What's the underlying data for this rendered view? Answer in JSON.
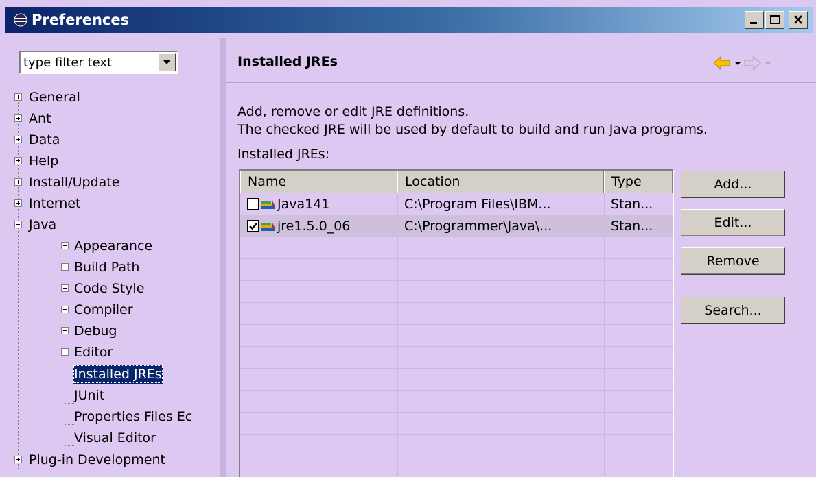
{
  "window": {
    "title": "Preferences",
    "minimize": "minimize",
    "maximize": "maximize",
    "close": "close"
  },
  "filter": {
    "value": "type filter text"
  },
  "tree": {
    "items": [
      {
        "label": "General",
        "expander": "plus"
      },
      {
        "label": "Ant",
        "expander": "plus"
      },
      {
        "label": "Data",
        "expander": "plus"
      },
      {
        "label": "Help",
        "expander": "plus"
      },
      {
        "label": "Install/Update",
        "expander": "plus"
      },
      {
        "label": "Internet",
        "expander": "plus"
      },
      {
        "label": "Java",
        "expander": "minus"
      }
    ],
    "java_children": [
      {
        "label": "Appearance",
        "expander": "plus"
      },
      {
        "label": "Build Path",
        "expander": "plus"
      },
      {
        "label": "Code Style",
        "expander": "plus"
      },
      {
        "label": "Compiler",
        "expander": "plus"
      },
      {
        "label": "Debug",
        "expander": "plus"
      },
      {
        "label": "Editor",
        "expander": "plus"
      },
      {
        "label": "Installed JREs",
        "selected": true
      },
      {
        "label": "JUnit"
      },
      {
        "label": "Properties Files Ec"
      },
      {
        "label": "Visual Editor"
      }
    ],
    "after": [
      {
        "label": "Plug-in Development",
        "expander": "plus"
      }
    ]
  },
  "page": {
    "title": "Installed JREs",
    "description_line1": "Add, remove or edit JRE definitions.",
    "description_line2": "The checked JRE will be used by default to build and run Java programs.",
    "section_label": "Installed JREs:"
  },
  "table": {
    "columns": [
      "Name",
      "Location",
      "Type"
    ],
    "rows": [
      {
        "name": "Java141",
        "location": "C:\\Program Files\\IBM...",
        "type": "Stan...",
        "checked": false
      },
      {
        "name": "jre1.5.0_06",
        "location": "C:\\Programmer\\Java\\...",
        "type": "Stan...",
        "checked": true
      }
    ]
  },
  "buttons": {
    "add": "Add...",
    "edit": "Edit...",
    "remove": "Remove",
    "search": "Search..."
  },
  "colors": {
    "title_bar": "#0a246a",
    "panel_bg": "#dcc8f0",
    "selection": "#0a246a",
    "back_arrow": "#f5c400"
  }
}
